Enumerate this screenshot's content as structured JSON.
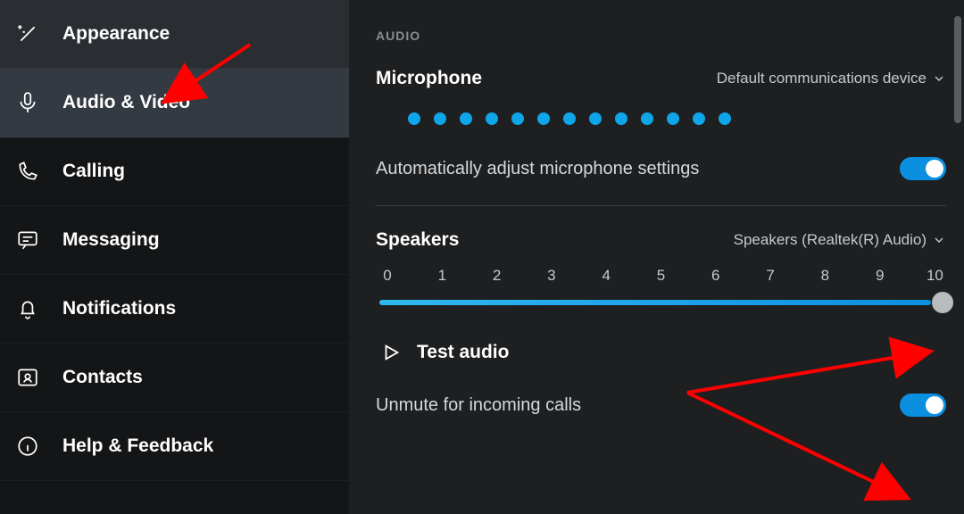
{
  "sidebar": {
    "items": [
      {
        "label": "Appearance"
      },
      {
        "label": "Audio & Video"
      },
      {
        "label": "Calling"
      },
      {
        "label": "Messaging"
      },
      {
        "label": "Notifications"
      },
      {
        "label": "Contacts"
      },
      {
        "label": "Help & Feedback"
      }
    ]
  },
  "main": {
    "section_title": "AUDIO",
    "microphone": {
      "title": "Microphone",
      "device": "Default communications device",
      "auto_adjust_label": "Automatically adjust microphone settings",
      "auto_adjust_on": true,
      "level_dots": 13
    },
    "speakers": {
      "title": "Speakers",
      "device": "Speakers (Realtek(R) Audio)",
      "ticks": [
        "0",
        "1",
        "2",
        "3",
        "4",
        "5",
        "6",
        "7",
        "8",
        "9",
        "10"
      ],
      "value": 10,
      "test_label": "Test audio",
      "unmute_label": "Unmute for incoming calls",
      "unmute_on": true
    }
  }
}
